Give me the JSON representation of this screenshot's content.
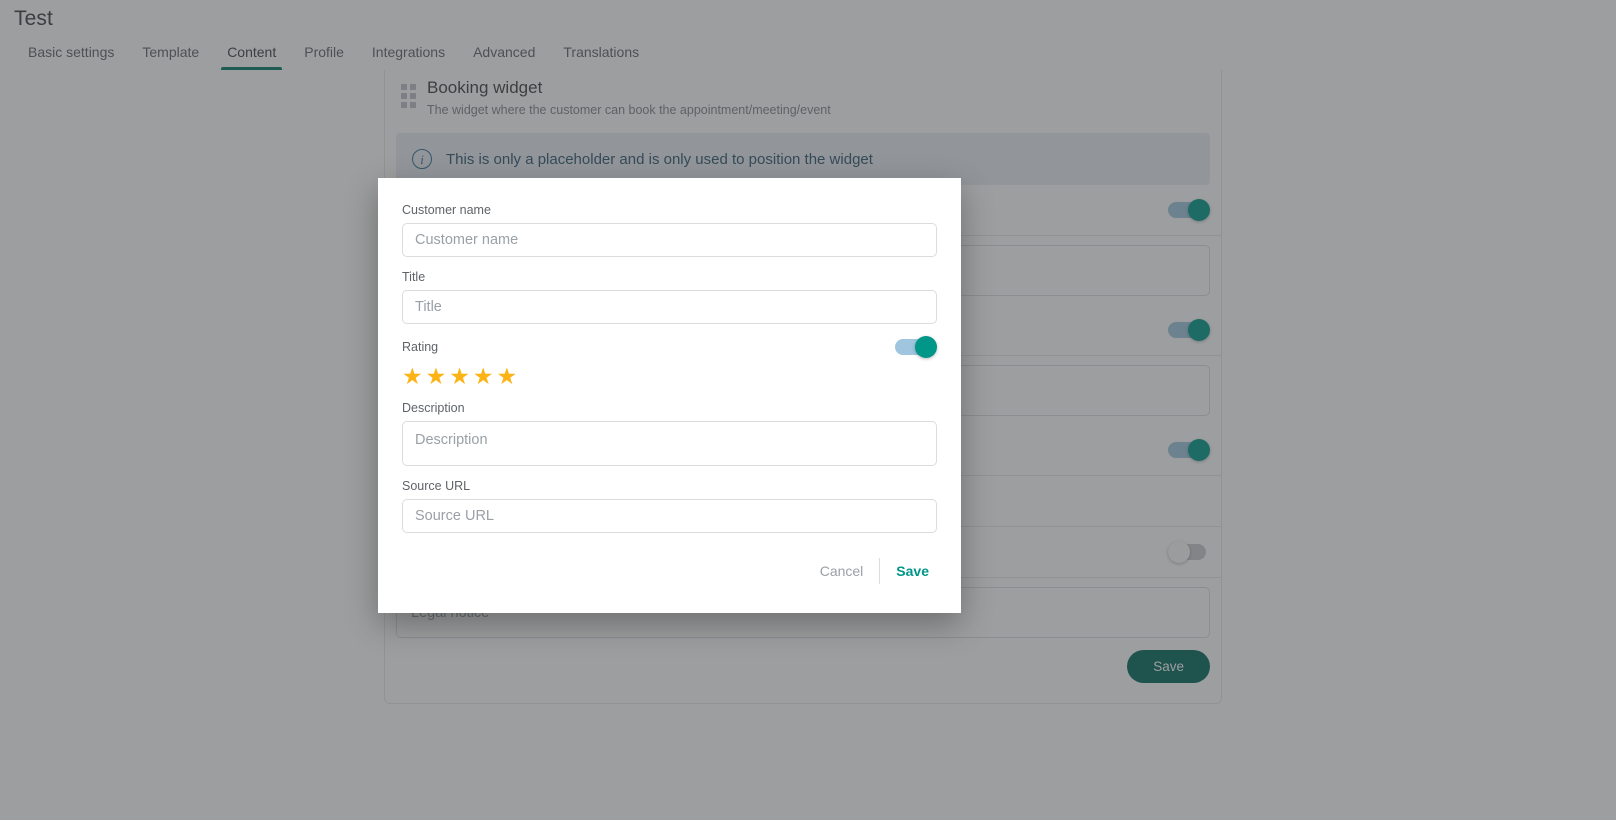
{
  "header": {
    "title": "Test",
    "tabs": [
      {
        "label": "Basic settings",
        "active": false
      },
      {
        "label": "Template",
        "active": false
      },
      {
        "label": "Content",
        "active": true
      },
      {
        "label": "Profile",
        "active": false
      },
      {
        "label": "Integrations",
        "active": false
      },
      {
        "label": "Advanced",
        "active": false
      },
      {
        "label": "Translations",
        "active": false
      }
    ]
  },
  "widget": {
    "title": "Booking widget",
    "subtitle": "The widget where the customer can book the appointment/meeting/event",
    "info_banner": {
      "icon": "info-circle-icon",
      "text": "This is only a placeholder and is only used to position the widget"
    },
    "legal_notice_placeholder": "Legal notice",
    "save_label": "Save"
  },
  "modal": {
    "fields": [
      {
        "label": "Customer name",
        "placeholder": "Customer name",
        "value": "",
        "type": "text"
      },
      {
        "label": "Title",
        "placeholder": "Title",
        "value": "",
        "type": "text"
      },
      {
        "label": "Description",
        "placeholder": "Description",
        "value": "",
        "type": "textarea"
      },
      {
        "label": "Source URL",
        "placeholder": "Source URL",
        "value": "",
        "type": "text"
      }
    ],
    "rating": {
      "label": "Rating",
      "enabled": true,
      "stars_filled": 5,
      "stars_total": 5,
      "star_glyph": "★★★★★"
    },
    "cancel_label": "Cancel",
    "save_label": "Save"
  },
  "colors": {
    "accent_teal": "#009688",
    "save_button": "#00695c",
    "star_amber": "#fcb316",
    "switch_on_track": "#9fc6de",
    "info_banner_bg": "#e8eef4",
    "info_banner_text": "#2e5871"
  }
}
